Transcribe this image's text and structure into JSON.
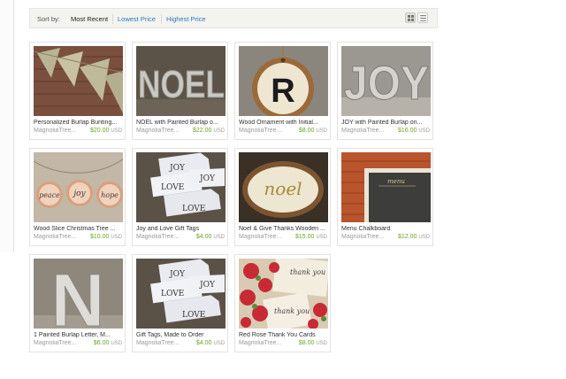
{
  "sort": {
    "label": "Sort by:",
    "options": [
      "Most Recent",
      "Lowest Price",
      "Highest Price"
    ],
    "grid_view_icon": "grid-icon",
    "list_view_icon": "list-icon"
  },
  "listings": [
    {
      "title": "Personalized Burlap Bunting...",
      "shop": "MagnoliaTree...",
      "price": "$20.00",
      "currency": "USD"
    },
    {
      "title": "NOEL with Painted Burlap o...",
      "shop": "MagnoliaTree...",
      "price": "$22.00",
      "currency": "USD",
      "letters": "NOEL"
    },
    {
      "title": "Wood Ornament with Initial...",
      "shop": "MagnoliaTree...",
      "price": "$8.00",
      "currency": "USD",
      "letters": "R"
    },
    {
      "title": "JOY with Painted Burlap on...",
      "shop": "MagnoliaTree...",
      "price": "$16.00",
      "currency": "USD",
      "letters": "JOY"
    },
    {
      "title": "Wood Slice Christmas Tree ...",
      "shop": "MagnoliaTree...",
      "price": "$10.00",
      "currency": "USD",
      "words": [
        "peace",
        "joy",
        "hope"
      ]
    },
    {
      "title": "Joy and Love Gift Tags",
      "shop": "MagnoliaTree...",
      "price": "$4.00",
      "currency": "USD",
      "words": [
        "JOY",
        "JOY",
        "LOVE",
        "LOVE"
      ]
    },
    {
      "title": "Noel & Give Thanks Wooden ...",
      "shop": "MagnoliaTree...",
      "price": "$15.00",
      "currency": "USD",
      "words": [
        "noel"
      ]
    },
    {
      "title": "Menu Chalkboard",
      "shop": "MagnoliaTree...",
      "price": "$12.00",
      "currency": "USD",
      "words": [
        "menu"
      ]
    },
    {
      "title": "1 Painted Burlap Letter, M...",
      "shop": "MagnoliaTree...",
      "price": "$6.00",
      "currency": "USD",
      "letters": "N"
    },
    {
      "title": "Gift Tags, Made to Order",
      "shop": "MagnoliaTree...",
      "price": "$4.00",
      "currency": "USD",
      "words": [
        "JOY",
        "JOY",
        "LOVE",
        "LOVE"
      ]
    },
    {
      "title": "Red Rose Thank You Cards",
      "shop": "MagnoliaTree...",
      "price": "$8.00",
      "currency": "USD",
      "words": [
        "thank you",
        "thank you"
      ]
    }
  ]
}
